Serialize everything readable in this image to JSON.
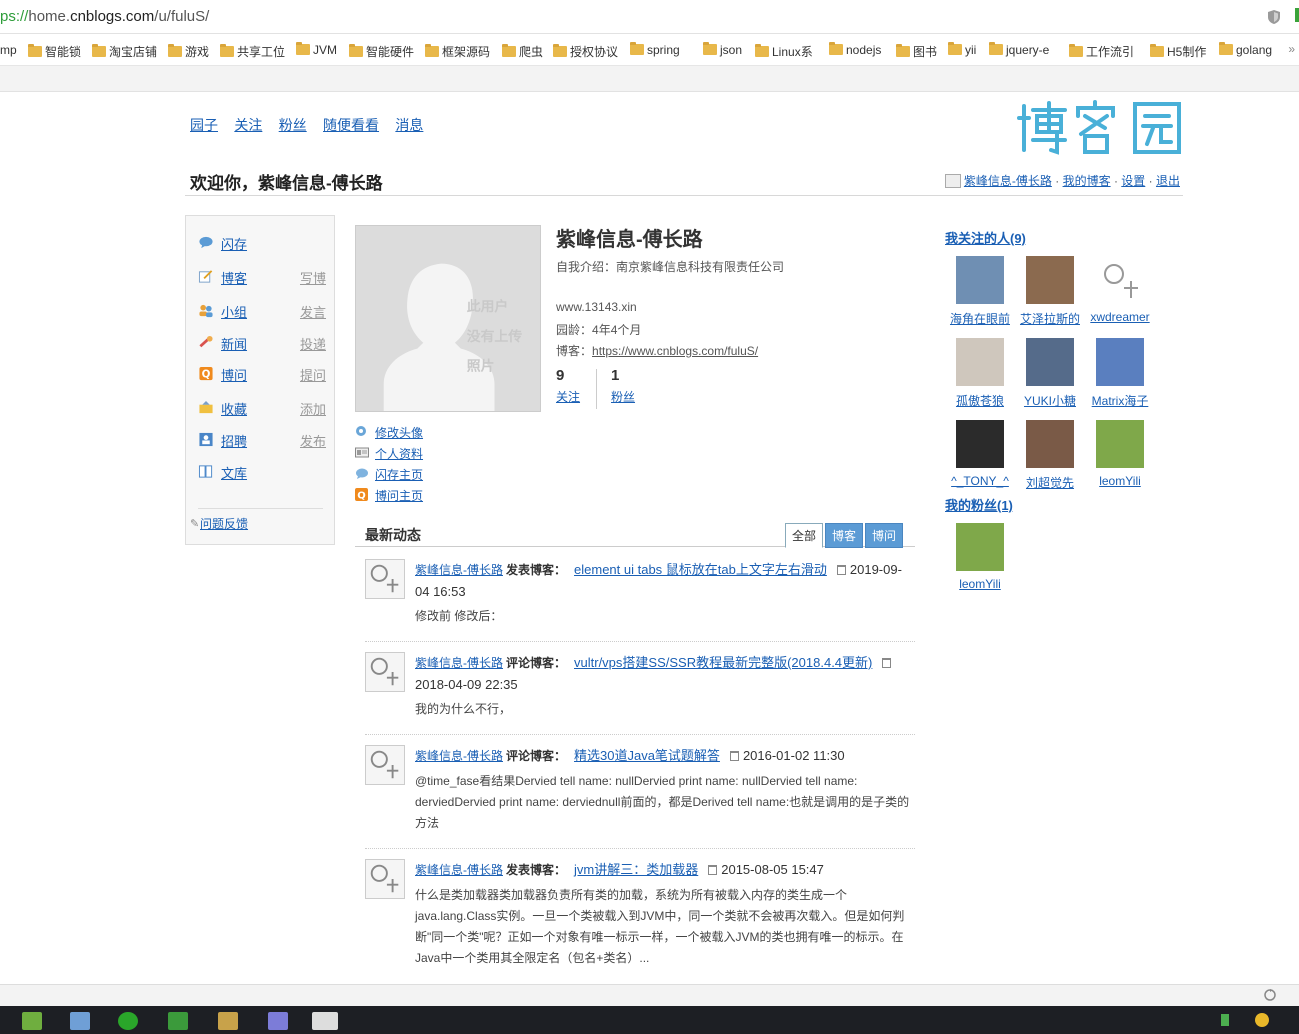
{
  "browser": {
    "url_scheme": "ps://",
    "url_sub": "home.",
    "url_host": "cnblogs.com",
    "url_path": "/u/fuluS/",
    "bookmarks": [
      "mp",
      "智能锁",
      "淘宝店铺",
      "游戏",
      "共享工位",
      "JVM",
      "智能硬件",
      "框架源码",
      "爬虫",
      "授权协议",
      "spring",
      "json",
      "Linux系",
      "nodejs",
      "图书",
      "yii",
      "jquery-e",
      "工作流引",
      "H5制作",
      "golang"
    ],
    "bookmarks_more": "»"
  },
  "topnav": [
    "园子",
    "关注",
    "粉丝",
    "随便看看",
    "消息"
  ],
  "logo_text": "博客园",
  "welcome": "欢迎你，紫峰信息-傅长路",
  "userbar": {
    "name": "紫峰信息-傅长路",
    "my_blog": "我的博客",
    "settings": "设置",
    "logout": "退出",
    "sep": "·"
  },
  "sidebar": {
    "items": [
      {
        "label": "闪存",
        "action": "",
        "icon": "speech-bubble-icon"
      },
      {
        "label": "博客",
        "action": "写博",
        "icon": "pencil-doc-icon"
      },
      {
        "label": "小组",
        "action": "发言",
        "icon": "group-icon"
      },
      {
        "label": "新闻",
        "action": "投递",
        "icon": "news-icon"
      },
      {
        "label": "博问",
        "action": "提问",
        "icon": "question-icon"
      },
      {
        "label": "收藏",
        "action": "添加",
        "icon": "bookmark-folder-icon"
      },
      {
        "label": "招聘",
        "action": "发布",
        "icon": "contact-card-icon"
      },
      {
        "label": "文库",
        "action": "",
        "icon": "book-icon"
      }
    ],
    "feedback": "问题反馈"
  },
  "profile": {
    "avatar_text": [
      "此用户",
      "没有上传",
      "照片"
    ],
    "name": "紫峰信息-傅长路",
    "intro_label": "自我介绍：",
    "intro": "南京紫峰信息科技有限责任公司",
    "website": "www.13143.xin",
    "age_label": "园龄：",
    "age": "4年4个月",
    "blog_label": "博客：",
    "blog_url": "https://www.cnblogs.com/fuluS/",
    "following_count": "9",
    "following_label": "关注",
    "followers_count": "1",
    "followers_label": "粉丝"
  },
  "quicklinks": [
    {
      "label": "修改头像",
      "icon": "avatar-edit-icon"
    },
    {
      "label": "个人资料",
      "icon": "id-card-icon"
    },
    {
      "label": "闪存主页",
      "icon": "chat-icon"
    },
    {
      "label": "博问主页",
      "icon": "question-icon"
    }
  ],
  "feed": {
    "title": "最新动态",
    "tabs": [
      "全部",
      "博客",
      "博问"
    ],
    "items": [
      {
        "author": "紫峰信息-傅长路",
        "verb": "发表博客：",
        "post": "element ui tabs 鼠标放在tab上文字左右滑动",
        "time": "2019-09-04 16:53",
        "desc": "修改前 修改后："
      },
      {
        "author": "紫峰信息-傅长路",
        "verb": "评论博客：",
        "post": "vultr/vps搭建SS/SSR教程最新完整版(2018.4.4更新)",
        "time": "2018-04-09 22:35",
        "desc": "我的为什么不行，"
      },
      {
        "author": "紫峰信息-傅长路",
        "verb": "评论博客：",
        "post": "精选30道Java笔试题解答",
        "time": "2016-01-02 11:30",
        "desc": "@time_fase看结果Dervied tell name: nullDervied print name: nullDervied tell name: derviedDervied print name: derviednull前面的，都是Derived tell name:也就是调用的是子类的方法"
      },
      {
        "author": "紫峰信息-傅长路",
        "verb": "发表博客：",
        "post": "jvm讲解三：类加载器",
        "time": "2015-08-05 15:47",
        "desc": "什么是类加载器类加载器负责所有类的加载，系统为所有被载入内存的类生成一个java.lang.Class实例。一旦一个类被载入到JVM中，同一个类就不会被再次载入。但是如何判断\"同一个类\"呢？正如一个对象有唯一标示一样，一个被载入JVM的类也拥有唯一的标示。在Java中一个类用其全限定名（包名+类名）..."
      }
    ]
  },
  "following": {
    "title": "我关注的人(9)",
    "people": [
      {
        "name": "海角在眼前",
        "color": "#6f8fb3"
      },
      {
        "name": "艾泽拉斯的",
        "color": "#8b6a4f"
      },
      {
        "name": "xwdreamer",
        "color": "#ffffff"
      },
      {
        "name": "孤傲苍狼",
        "color": "#cfc7bd"
      },
      {
        "name": "YUKI小糖",
        "color": "#556b8a"
      },
      {
        "name": "Matrix海子",
        "color": "#5a7fbf"
      },
      {
        "name": "^_TONY_^",
        "color": "#2b2b2b"
      },
      {
        "name": "刘超觉先",
        "color": "#7a5a47"
      },
      {
        "name": "leomYili",
        "color": "#7fa84a"
      }
    ]
  },
  "followers": {
    "title": "我的粉丝(1)",
    "people": [
      {
        "name": "leomYili",
        "color": "#7fa84a"
      }
    ]
  }
}
